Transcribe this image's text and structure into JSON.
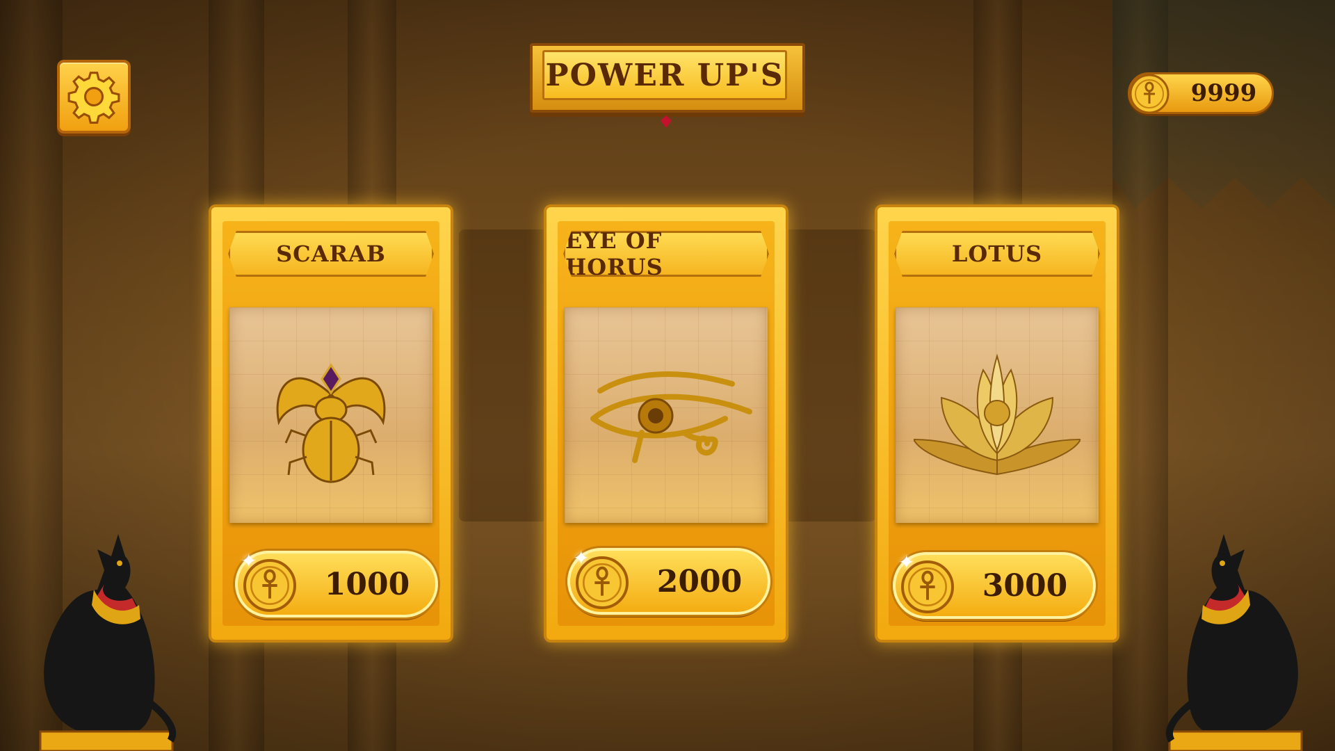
{
  "header": {
    "title": "POWER UP'S",
    "coin_balance": "9999"
  },
  "cards": [
    {
      "name": "SCARAB",
      "price": "1000"
    },
    {
      "name": "EYE OF HORUS",
      "price": "2000"
    },
    {
      "name": "LOTUS",
      "price": "3000"
    }
  ],
  "icons": {
    "settings": "gear-icon",
    "coin": "ankh-coin-icon",
    "card_0": "scarab-icon",
    "card_1": "eye-of-horus-icon",
    "card_2": "lotus-icon",
    "decor": "bastet-cat-statue"
  },
  "colors": {
    "gold": "#f7bc1f",
    "dark_brown_text": "#5a2a06",
    "background": "#6e4a1c"
  }
}
